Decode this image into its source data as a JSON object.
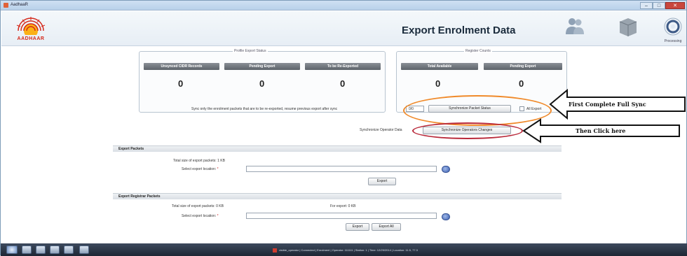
{
  "window": {
    "title": "AadhaaR",
    "icon": "app-icon",
    "controls": [
      "minimize",
      "maximize",
      "close"
    ]
  },
  "header": {
    "logo_text": "AADHAAR",
    "page_title": "Export Enrolment Data",
    "icons": [
      "users-icon",
      "box-icon",
      "processing-icon"
    ],
    "processing_label": "Processing"
  },
  "profile_export_status": {
    "title": "Profile Export Status",
    "columns": [
      "Unsynced CIDR Records",
      "Pending Export",
      "To be Re-Exported"
    ],
    "values": [
      "0",
      "0",
      "0"
    ]
  },
  "register_counts": {
    "title": "Register Counts",
    "columns": [
      "Total Available",
      "Pending Export"
    ],
    "values": [
      "0",
      "0"
    ]
  },
  "sync_row": {
    "text": "Sync only the enrolment packets that are to be re-exported, resume previous export after sync",
    "value": "0/0",
    "sync_button": "Synchronize Packet Status",
    "checkbox_label": "All Export"
  },
  "sync_complete_row": {
    "text": "Synchronize Operator Data",
    "button": "Synchronize Operators Changes"
  },
  "callouts": {
    "first": "First Complete Full Sync",
    "then": "Then Click here"
  },
  "export_packets": {
    "section": "Export Packets",
    "total_size": "Total size of export packets: 1 KB",
    "location_label": "Select export location:",
    "location_value": "",
    "export_button": "Export"
  },
  "export_register": {
    "section": "Export Registrar Packets",
    "total_size": "Total size of export packets: 0 KB",
    "for_export": "For export: 0 KB",
    "location_label": "Select export location:",
    "location_value": "",
    "export_button": "Export",
    "export_all_button": "Export All"
  },
  "taskbar": {
    "status_text": "visible_operator | Connected | Enrolment | Operator: 111111 | Station: 1 | Time: 12/29/2014 | Location: 11.5, 77.3"
  },
  "colors": {
    "orange_highlight": "#f08a2a",
    "red_highlight": "#b9293a",
    "header_button": "#6b7178"
  }
}
